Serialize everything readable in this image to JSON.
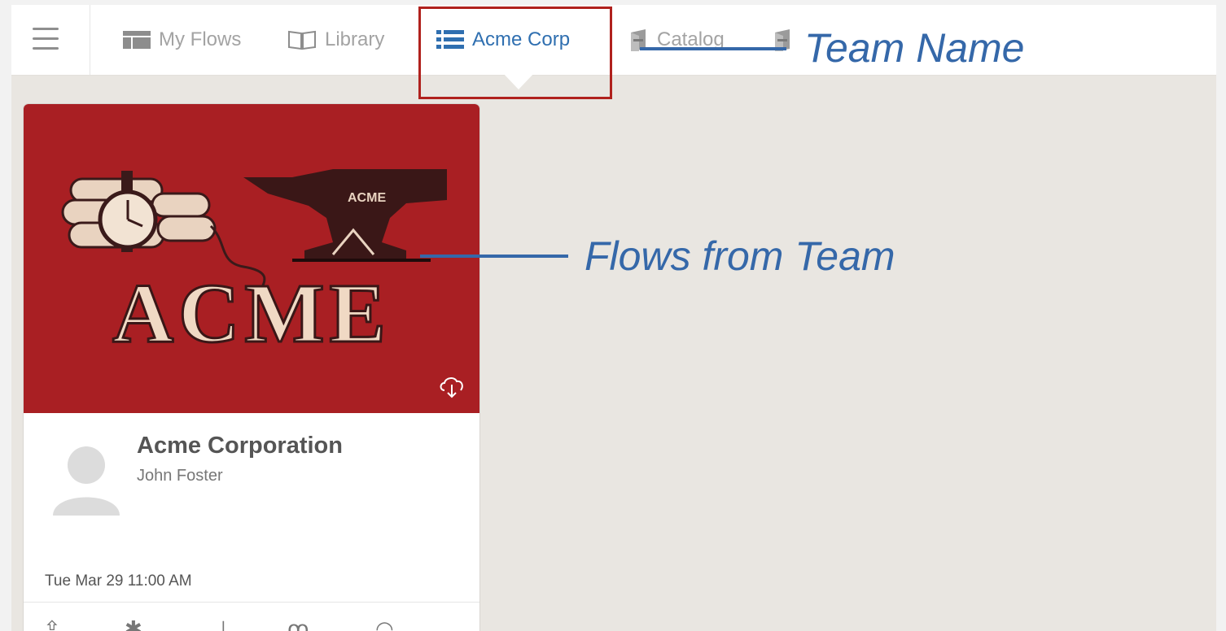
{
  "nav": {
    "menu_icon": "hamburger-icon",
    "tabs": [
      {
        "label": "My Flows",
        "icon": "table-layout-icon"
      },
      {
        "label": "Library",
        "icon": "open-book-icon"
      },
      {
        "label": "Acme Corp",
        "icon": "list-icon",
        "active": true
      },
      {
        "label": "Catalog",
        "icon": "catalog-stack-icon"
      }
    ],
    "extra_icon": "catalog-stack-icon"
  },
  "card": {
    "image_brand_large": "ACME",
    "image_brand_small": "ACME",
    "title": "Acme Corporation",
    "author": "John Foster",
    "date": "Tue Mar 29 11:00 AM",
    "download_icon": "cloud-download-icon",
    "actions": [
      "share-icon",
      "settings-icon",
      "pin-icon",
      "users-icon",
      "comment-icon"
    ]
  },
  "annotations": {
    "team_name": "Team Name",
    "flows_from_team": "Flows from Team"
  },
  "colors": {
    "accent": "#2f6fb0",
    "annotation": "#3568a9",
    "highlight": "#b0211d",
    "card_image_bg": "#a91f23",
    "background": "#e9e6e1"
  }
}
